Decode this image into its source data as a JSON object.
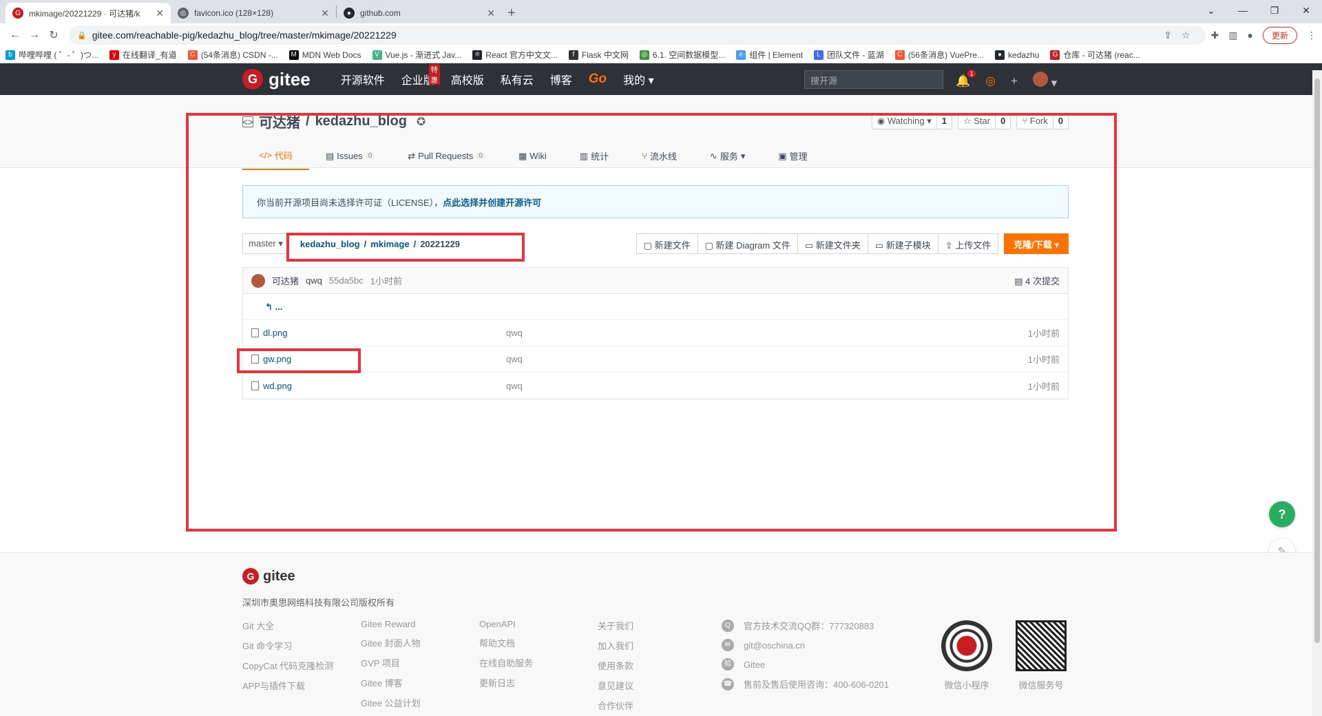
{
  "browser": {
    "tabs": [
      {
        "title": "mkimage/20221229 · 可达猪/k",
        "icon": "gitee-icon",
        "active": true
      },
      {
        "title": "favicon.ico (128×128)",
        "icon": "globe-icon",
        "active": false
      },
      {
        "title": "github.com",
        "icon": "github-icon",
        "active": false
      }
    ],
    "url": "gitee.com/reachable-pig/kedazhu_blog/tree/master/mkimage/20221229",
    "update_label": "更新",
    "bookmarks": [
      "哔哩哔哩 ( ゜- ゜)つ...",
      "在线翻译_有道",
      "(54条消息) CSDN -...",
      "MDN Web Docs",
      "Vue.js - 渐进式 Jav...",
      "React 官方中文文...",
      "Flask 中文网",
      "6.1. 空间数据模型...",
      "组件 | Element",
      "团队文件 - 蓝湖",
      "(56条消息) VuePre...",
      "kedazhu",
      "仓库 - 可达猪 (reac..."
    ]
  },
  "header": {
    "logo_text": "gitee",
    "nav": [
      "开源软件",
      "企业版",
      "高校版",
      "私有云",
      "博客",
      "Go",
      "我的"
    ],
    "enterprise_badge": "特惠",
    "search_placeholder": "搜开源",
    "notification_count": "1"
  },
  "repo": {
    "owner": "可达猪",
    "name": "kedazhu_blog",
    "watch_label": "Watching",
    "watch_count": "1",
    "star_label": "Star",
    "star_count": "0",
    "fork_label": "Fork",
    "fork_count": "0",
    "tabs": [
      {
        "label": "代码",
        "count": ""
      },
      {
        "label": "Issues",
        "count": "0"
      },
      {
        "label": "Pull Requests",
        "count": "0"
      },
      {
        "label": "Wiki",
        "count": ""
      },
      {
        "label": "统计",
        "count": ""
      },
      {
        "label": "流水线",
        "count": ""
      },
      {
        "label": "服务",
        "count": ""
      },
      {
        "label": "管理",
        "count": ""
      }
    ]
  },
  "license_notice": {
    "text": "你当前开源项目尚未选择许可证（LICENSE），",
    "link": "点此选择并创建开源许可"
  },
  "toolbar": {
    "branch": "master",
    "crumbs": [
      "kedazhu_blog",
      "mkimage",
      "20221229"
    ],
    "buttons": [
      "新建文件",
      "新建 Diagram 文件",
      "新建文件夹",
      "新建子模块",
      "上传文件"
    ],
    "clone_label": "克隆/下载"
  },
  "commit": {
    "author": "可达猪",
    "message": "qwq",
    "hash": "55da5bc",
    "time": "1小时前",
    "commits": "4 次提交"
  },
  "back_label": "...",
  "files": [
    {
      "name": "dl.png",
      "message": "qwq",
      "time": "1小时前"
    },
    {
      "name": "gw.png",
      "message": "qwq",
      "time": "1小时前"
    },
    {
      "name": "wd.png",
      "message": "qwq",
      "time": "1小时前"
    }
  ],
  "footer": {
    "logo_text": "gitee",
    "copyright": "深圳市奥思网络科技有限公司版权所有",
    "col1": [
      "Git 大全",
      "Git 命令学习",
      "CopyCat 代码克隆检测",
      "APP与插件下载"
    ],
    "col2": [
      "Gitee Reward",
      "Gitee 封面人物",
      "GVP 项目",
      "Gitee 博客",
      "Gitee 公益计划"
    ],
    "col3": [
      "OpenAPI",
      "帮助文档",
      "在线自助服务",
      "更新日志"
    ],
    "col4": [
      "关于我们",
      "加入我们",
      "使用条款",
      "意见建议",
      "合作伙伴"
    ],
    "contacts": [
      "官方技术交流QQ群：777320883",
      "git@oschina.cn",
      "Gitee",
      "售前及售后使用咨询：400-606-0201"
    ],
    "qr1": "微信小程序",
    "qr2": "微信服务号"
  }
}
